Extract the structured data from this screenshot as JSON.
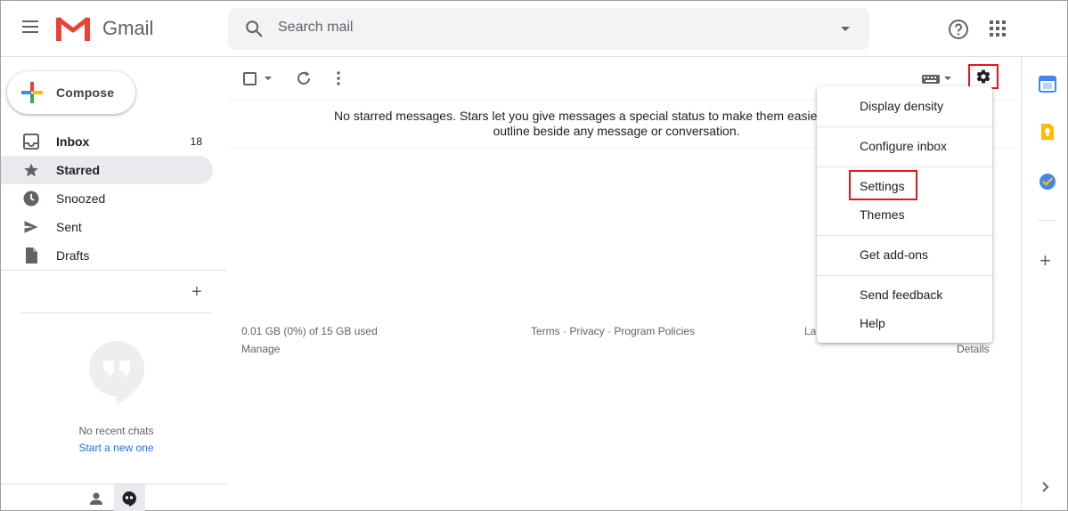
{
  "header": {
    "app_name": "Gmail",
    "search_placeholder": "Search mail"
  },
  "sidebar": {
    "compose_label": "Compose",
    "items": [
      {
        "label": "Inbox",
        "count": "18",
        "icon": "inbox-icon"
      },
      {
        "label": "Starred",
        "count": "",
        "icon": "star-icon"
      },
      {
        "label": "Snoozed",
        "count": "",
        "icon": "clock-icon"
      },
      {
        "label": "Sent",
        "count": "",
        "icon": "send-icon"
      },
      {
        "label": "Drafts",
        "count": "",
        "icon": "draft-icon"
      }
    ],
    "chats": {
      "empty_text": "No recent chats",
      "start_link": "Start a new one"
    }
  },
  "main": {
    "empty_message_line1": "No starred messages. Stars let you give messages a special status to make them easier to find. To sta",
    "empty_message_line2": "outline beside any message or conversation.",
    "footer": {
      "storage": "0.01 GB (0%) of 15 GB used",
      "manage": "Manage",
      "terms": "Terms",
      "privacy": "Privacy",
      "program_policies": "Program Policies",
      "separator": " · ",
      "last_activity_partial": "La",
      "details": "Details"
    }
  },
  "settings_menu": {
    "items": [
      "Display density",
      "Configure inbox",
      "Settings",
      "Themes",
      "Get add-ons",
      "Send feedback",
      "Help"
    ]
  },
  "colors": {
    "highlight": "#e8141d",
    "link": "#1a73e8",
    "active_nav_bg": "#e8eaed"
  }
}
